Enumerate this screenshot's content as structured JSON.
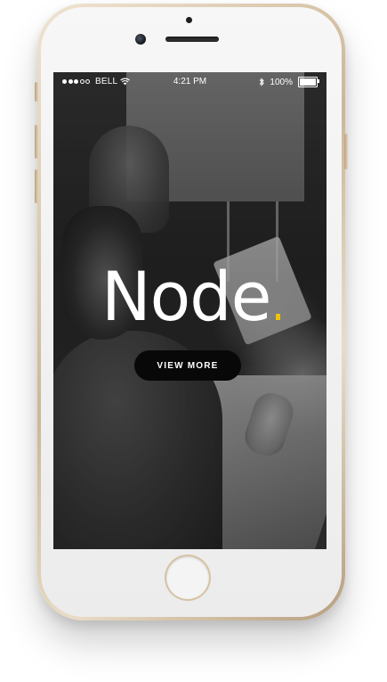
{
  "status_bar": {
    "carrier": "BELL",
    "time": "4:21 PM",
    "battery": "100%",
    "battery_level": 1.0,
    "signal_strength": 3,
    "signal_max": 5
  },
  "hero": {
    "brand": "Node",
    "brand_accent_color": "#f2c200",
    "cta_label": "VIEW MORE"
  },
  "icons": {
    "wifi": "wifi-icon",
    "bluetooth": "bluetooth-icon",
    "battery": "battery-icon",
    "signal": "signal-icon"
  }
}
